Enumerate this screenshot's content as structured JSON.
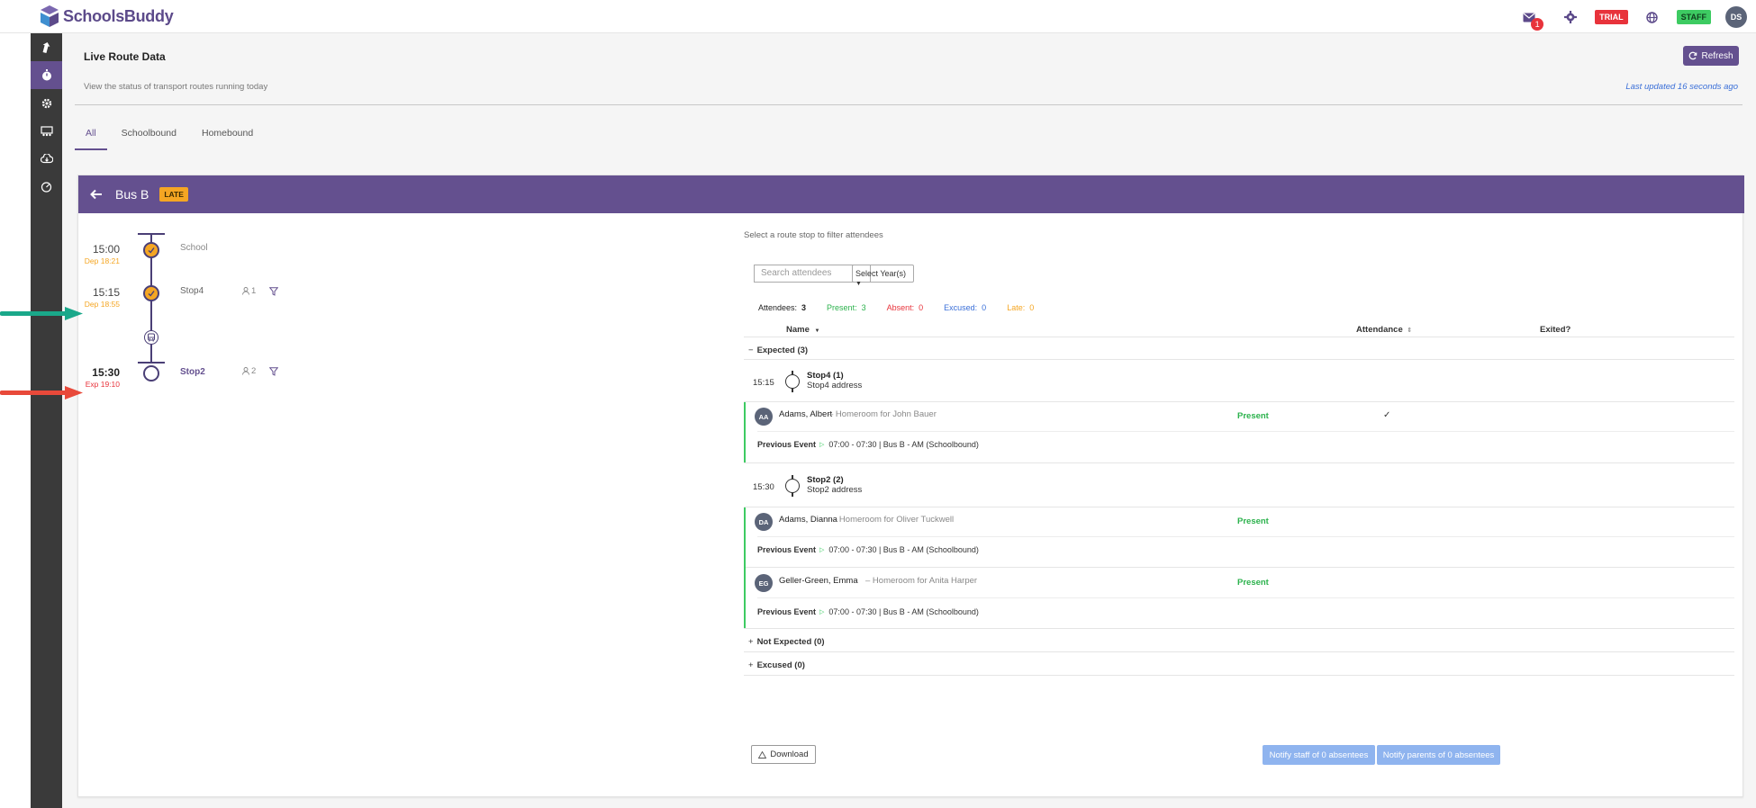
{
  "app": {
    "name": "SchoolsBuddy"
  },
  "topbar": {
    "notifications_count": "1",
    "trial_label": "TRIAL",
    "staff_label": "STAFF",
    "user_initials": "DS"
  },
  "page": {
    "title": "Live Route Data",
    "subtitle": "View the status of transport routes running today",
    "refresh_label": "Refresh",
    "last_updated": "Last updated 16 seconds ago"
  },
  "tabs": [
    {
      "label": "All",
      "active": true
    },
    {
      "label": "Schoolbound",
      "active": false
    },
    {
      "label": "Homebound",
      "active": false
    }
  ],
  "route": {
    "bus_name": "Bus B",
    "status_badge": "LATE",
    "stops": [
      {
        "time": "15:00",
        "sub": "Dep 18:21",
        "name": "School",
        "count": ""
      },
      {
        "time": "15:15",
        "sub": "Dep 18:55",
        "name": "Stop4",
        "count": "1"
      },
      {
        "time": "15:30",
        "sub": "Exp 19:10",
        "name": "Stop2",
        "count": "2"
      }
    ]
  },
  "attendees": {
    "hint": "Select a route stop to filter attendees",
    "search_placeholder": "Search attendees",
    "year_select": "Select Year(s)",
    "counts": {
      "attendees_label": "Attendees:",
      "attendees": "3",
      "present_label": "Present:",
      "present": "3",
      "absent_label": "Absent:",
      "absent": "0",
      "excused_label": "Excused:",
      "excused": "0",
      "late_label": "Late:",
      "late": "0"
    },
    "columns": {
      "name": "Name",
      "attendance": "Attendance",
      "exited": "Exited?"
    },
    "groups": {
      "expected": "Expected (3)",
      "not_expected": "Not Expected (0)",
      "excused": "Excused (0)"
    },
    "stops": [
      {
        "time": "15:15",
        "name": "Stop4 (1)",
        "address": "Stop4 address"
      },
      {
        "time": "15:30",
        "name": "Stop2 (2)",
        "address": "Stop2 address"
      }
    ],
    "students": [
      {
        "initials": "AA",
        "name": "Adams, Albert",
        "homeroom": "– Homeroom for John Bauer",
        "attendance": "Present",
        "exited": "✓",
        "prev_label": "Previous Event",
        "prev_event": "07:00 - 07:30 | Bus B - AM (Schoolbound)"
      },
      {
        "initials": "DA",
        "name": "Adams, Dianna",
        "homeroom": "– Homeroom for Oliver Tuckwell",
        "attendance": "Present",
        "exited": "",
        "prev_label": "Previous Event",
        "prev_event": "07:00 - 07:30 | Bus B - AM (Schoolbound)"
      },
      {
        "initials": "EG",
        "name": "Geller-Green, Emma",
        "homeroom": "– Homeroom for Anita Harper",
        "attendance": "Present",
        "exited": "",
        "prev_label": "Previous Event",
        "prev_event": "07:00 - 07:30 | Bus B - AM (Schoolbound)"
      }
    ],
    "download_label": "Download",
    "notify_staff_label": "Notify staff of 0 absentees",
    "notify_parents_label": "Notify parents of 0 absentees"
  },
  "colors": {
    "brand": "#64508f",
    "late": "#f5a623",
    "present": "#2bb24c",
    "absent": "#e8333b",
    "excused": "#3a6fd8",
    "annotation_green": "#1aa88a",
    "annotation_red": "#e8493a"
  }
}
